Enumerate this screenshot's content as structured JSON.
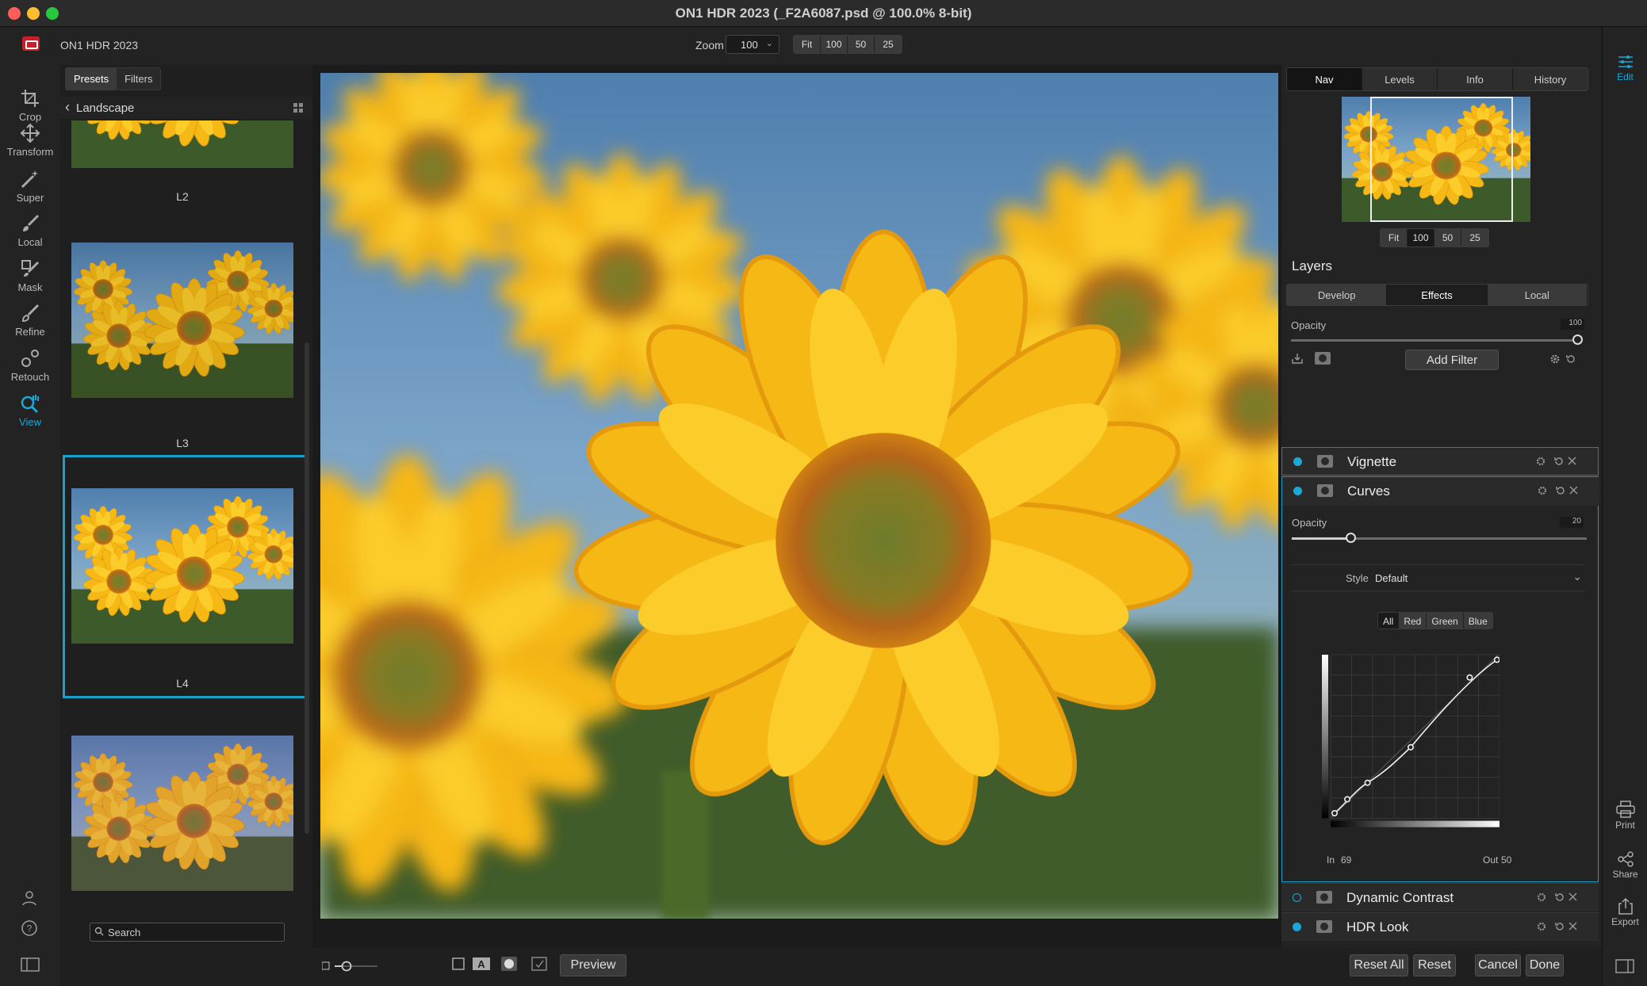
{
  "window": {
    "title": "ON1 HDR 2023 (_F2A6087.psd @ 100.0% 8-bit)"
  },
  "toolbar": {
    "app_name": "ON1 HDR 2023",
    "zoom_label": "Zoom",
    "zoom_value": "100",
    "zoom_buttons": [
      "Fit",
      "100",
      "50",
      "25"
    ]
  },
  "tools": [
    {
      "label": "Crop",
      "icon": "crop-icon"
    },
    {
      "label": "Transform",
      "icon": "move-arrows-icon"
    },
    {
      "label": "Super",
      "icon": "magic-wand-icon"
    },
    {
      "label": "Local",
      "icon": "brush-icon"
    },
    {
      "label": "Mask",
      "icon": "mask-brush-icon"
    },
    {
      "label": "Refine",
      "icon": "refine-brush-icon"
    },
    {
      "label": "Retouch",
      "icon": "retouch-icon"
    },
    {
      "label": "View",
      "icon": "zoom-hand-icon",
      "active": true
    }
  ],
  "browser": {
    "tabs": [
      "Presets",
      "Filters"
    ],
    "active_tab": "Presets",
    "breadcrumb": "Landscape",
    "presets": [
      {
        "label": "L2"
      },
      {
        "label": "L3"
      },
      {
        "label": "L4",
        "selected": true
      },
      {
        "label": ""
      }
    ],
    "search_placeholder": "Search"
  },
  "bottom": {
    "preview_label": "Preview",
    "reset_all_label": "Reset All",
    "reset_label": "Reset",
    "cancel_label": "Cancel",
    "done_label": "Done"
  },
  "right": {
    "nav_tabs": [
      "Nav",
      "Levels",
      "Info",
      "History"
    ],
    "active_nav_tab": "Nav",
    "nav_zoom_buttons": [
      "Fit",
      "100",
      "50",
      "25"
    ],
    "layers_title": "Layers",
    "layer_tabs": [
      "Develop",
      "Effects",
      "Local"
    ],
    "active_layer_tab": "Effects",
    "opacity_label": "Opacity",
    "opacity_value": "100",
    "add_filter_label": "Add Filter",
    "filters": {
      "vignette": {
        "name": "Vignette",
        "enabled": true
      },
      "curves": {
        "name": "Curves",
        "enabled": true,
        "opacity_label": "Opacity",
        "opacity_value": "20",
        "opacity_level": 0.2,
        "style_label": "Style",
        "style_value": "Default",
        "channels": [
          "All",
          "Red",
          "Green",
          "Blue"
        ],
        "active_channel": "All",
        "in_label": "In",
        "in_value": "69",
        "out_label": "Out",
        "out_value": "50"
      },
      "dynamic_contrast": {
        "name": "Dynamic Contrast",
        "enabled": false
      },
      "hdr_look": {
        "name": "HDR Look",
        "enabled": true
      }
    }
  },
  "right_strip": {
    "edit_label": "Edit",
    "print_label": "Print",
    "share_label": "Share",
    "export_label": "Export"
  },
  "colors": {
    "accent": "#1ba8d6",
    "close": "#ff5f57",
    "minimize": "#febc2e",
    "maximize": "#28c840"
  }
}
